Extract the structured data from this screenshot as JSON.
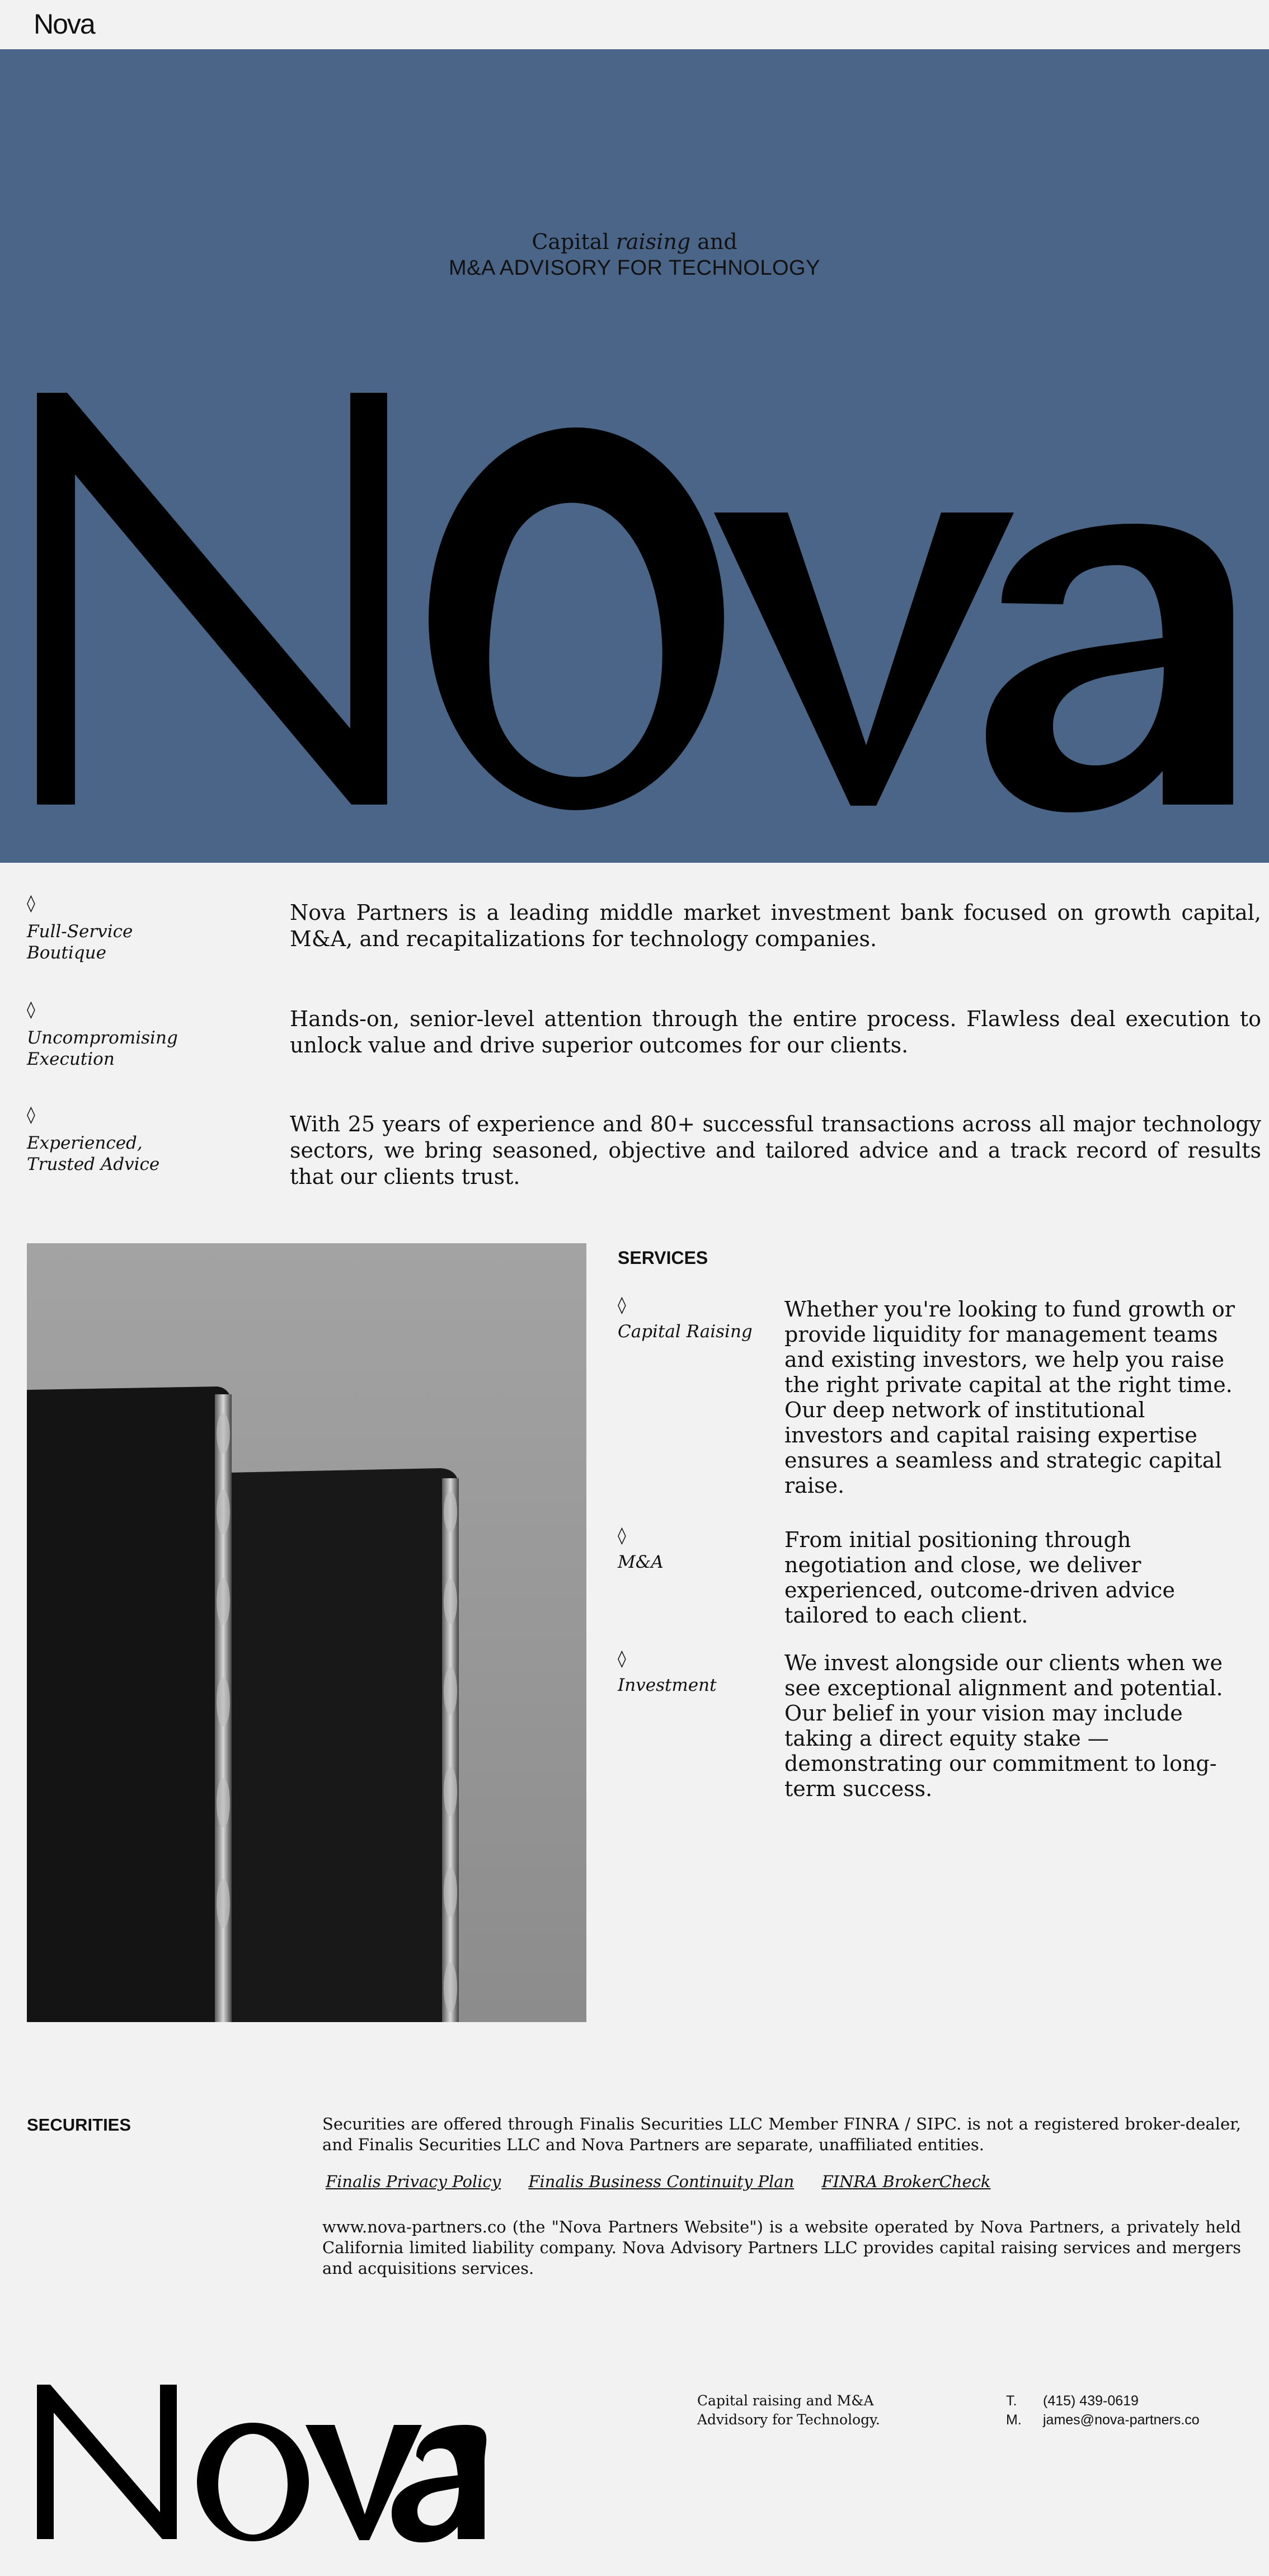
{
  "nav": {
    "logo": "Nova"
  },
  "hero": {
    "tagline_pre": "Capital ",
    "tagline_em": "raising",
    "tagline_post": " and",
    "tagline_line2": "M&A ADVISORY FOR TECHNOLOGY",
    "wordmark": "Nova",
    "background_color": "#4a6587"
  },
  "intro": [
    {
      "label_line1": "Full-Service",
      "label_line2": "Boutique",
      "text": "Nova Partners is a leading middle market investment bank focused on growth capital, M&A, and recapitalizations for technology companies."
    },
    {
      "label_line1": "Uncompromising",
      "label_line2": "Execution",
      "text": "Hands-on, senior-level attention through the entire process. Flawless deal execution to unlock value and drive superior outcomes for our clients."
    },
    {
      "label_line1": "Experienced,",
      "label_line2": "Trusted Advice",
      "text": "With 25 years of experience and 80+ successful transactions across all major technology sectors, we bring seasoned, objective and tailored advice and a track record of results that our clients trust."
    }
  ],
  "bullet_glyph": "◊",
  "services": {
    "heading": "SERVICES",
    "items": [
      {
        "label": "Capital Raising",
        "text": "Whether you're looking to fund growth or provide liquidity for management teams and existing investors, we help you raise the right private capital at the right time. Our deep network of institutional investors and capital raising expertise ensures a seamless and strategic capital raise."
      },
      {
        "label": "M&A",
        "text": "From initial positioning through negotiation and close, we deliver experienced, outcome-driven advice tailored to each client."
      },
      {
        "label": "Investment",
        "text": "We invest alongside our clients when we see exceptional alignment and potential. Our belief in your vision may include taking a direct equity stake — demonstrating our commitment to long-term success."
      }
    ]
  },
  "securities": {
    "heading": "SECURITIES",
    "body": "Securities are offered through Finalis Securities LLC Member FINRA / SIPC.  is not a registered broker-dealer, and Finalis Securities LLC and Nova Partners are separate, unaffiliated entities.",
    "links": [
      "Finalis Privacy Policy",
      "Finalis Business Continuity Plan",
      "FINRA BrokerCheck"
    ],
    "site_note": "www.nova-partners.co (the \"Nova Partners Website\") is a website operated by Nova Partners, a privately held California limited liability company. Nova Advisory Partners LLC provides capital raising services and mergers and acquisitions services."
  },
  "footer": {
    "wordmark": "Nova",
    "tagline_line1": "Capital raising and M&A",
    "tagline_line2": "Advidsory for Technology.",
    "contacts": [
      {
        "key": "T.",
        "value": "(415) 439-0619"
      },
      {
        "key": "M.",
        "value": "james@nova-partners.co"
      }
    ]
  }
}
